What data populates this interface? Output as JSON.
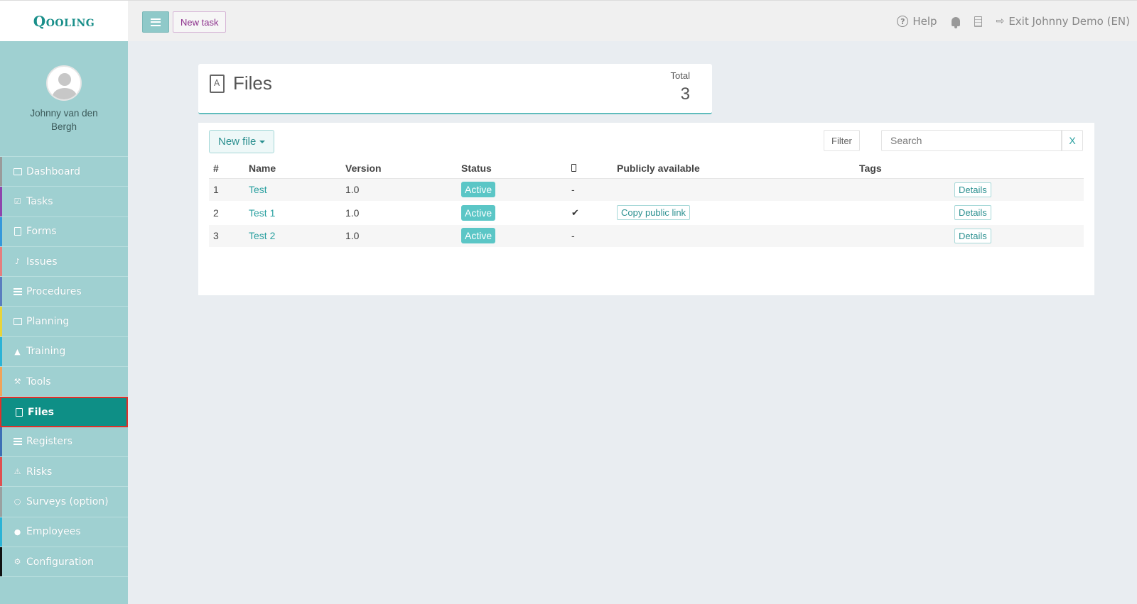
{
  "brand": {
    "logo": "Qooling"
  },
  "topbar": {
    "new_task_label": "New task",
    "help_label": "Help",
    "exit_label": "Exit Johnny Demo (EN)"
  },
  "sidebar": {
    "user_name": "Johnny van den Bergh",
    "items": [
      {
        "label": "Dashboard",
        "icon": "monitor-icon",
        "color": "#9a9a9a"
      },
      {
        "label": "Tasks",
        "icon": "checkbox-icon",
        "color": "#8e44ad"
      },
      {
        "label": "Forms",
        "icon": "document-icon",
        "color": "#3498db"
      },
      {
        "label": "Issues",
        "icon": "bell-icon",
        "color": "#e67e7e"
      },
      {
        "label": "Procedures",
        "icon": "list-icon",
        "color": "#5a7dbf"
      },
      {
        "label": "Planning",
        "icon": "calendar-icon",
        "color": "#e8d43a"
      },
      {
        "label": "Training",
        "icon": "graduation-cap-icon",
        "color": "#2bb3d6"
      },
      {
        "label": "Tools",
        "icon": "wrench-icon",
        "color": "#f0a35a"
      },
      {
        "label": "Files",
        "icon": "pdf-file-icon",
        "color": "#0e8f86"
      },
      {
        "label": "Registers",
        "icon": "lines-icon",
        "color": "#3d6fb5"
      },
      {
        "label": "Risks",
        "icon": "warning-icon",
        "color": "#e05050"
      },
      {
        "label": "Surveys (option)",
        "icon": "comment-icon",
        "color": "#9aa0a0"
      },
      {
        "label": "Employees",
        "icon": "users-icon",
        "color": "#2bb3d6"
      },
      {
        "label": "Configuration",
        "icon": "gear-icon",
        "color": "#111111"
      }
    ],
    "active_index": 8
  },
  "summary": {
    "title": "Files",
    "total_label": "Total",
    "total_value": "3"
  },
  "toolbar": {
    "new_file_label": "New file",
    "filter_label": "Filter",
    "search_placeholder": "Search",
    "clear_label": "X"
  },
  "table": {
    "headers": [
      "#",
      "Name",
      "Version",
      "Status",
      "",
      "Publicly available",
      "Tags",
      ""
    ],
    "rows": [
      {
        "num": "1",
        "name": "Test",
        "version": "1.0",
        "status": "Active",
        "mobile": "-",
        "public": "",
        "tags": "",
        "action": "Details"
      },
      {
        "num": "2",
        "name": "Test 1",
        "version": "1.0",
        "status": "Active",
        "mobile": "✔",
        "public": "Copy public link",
        "tags": "",
        "action": "Details"
      },
      {
        "num": "3",
        "name": "Test 2",
        "version": "1.0",
        "status": "Active",
        "mobile": "-",
        "public": "",
        "tags": "",
        "action": "Details"
      }
    ]
  },
  "colors": {
    "accent": "#0e8f86",
    "sidebar_bg": "#9fd0d1",
    "badge": "#5bc6c6",
    "active_outline": "#e0302a"
  }
}
